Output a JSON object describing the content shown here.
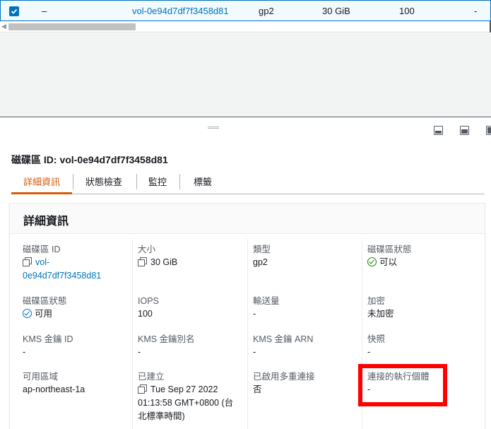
{
  "table": {
    "row": {
      "checked": true,
      "name": "–",
      "volume_id": "vol-0e94d7df7f3458d81",
      "type": "gp2",
      "size": "30 GiB",
      "iops": "100",
      "throughput": "-"
    }
  },
  "detail": {
    "title": "磁碟區 ID: vol-0e94d7df7f3458d81",
    "tabs": [
      {
        "label": "詳細資訊",
        "active": true
      },
      {
        "label": "狀態檢查",
        "active": false
      },
      {
        "label": "監控",
        "active": false
      },
      {
        "label": "標籤",
        "active": false
      }
    ],
    "card_title": "詳細資訊",
    "fields": {
      "volume_id": {
        "label": "磁碟區 ID",
        "value_line1": "vol-",
        "value_line2": "0e94d7df7f3458d81"
      },
      "size": {
        "label": "大小",
        "value": "30 GiB"
      },
      "type": {
        "label": "類型",
        "value": "gp2"
      },
      "volume_status": {
        "label": "磁碟區狀態",
        "value": "可以"
      },
      "volume_state": {
        "label": "磁碟區狀態",
        "value": "可用"
      },
      "iops": {
        "label": "IOPS",
        "value": "100"
      },
      "throughput": {
        "label": "輸送量",
        "value": "-"
      },
      "encryption": {
        "label": "加密",
        "value": "未加密"
      },
      "kms_key_id": {
        "label": "KMS 金鑰 ID",
        "value": "-"
      },
      "kms_key_alias": {
        "label": "KMS 金鑰別名",
        "value": "-"
      },
      "kms_key_arn": {
        "label": "KMS 金鑰 ARN",
        "value": "-"
      },
      "snapshot": {
        "label": "快照",
        "value": "-"
      },
      "availability_zone": {
        "label": "可用區域",
        "value": "ap-northeast-1a"
      },
      "created": {
        "label": "已建立",
        "value_line1": "Tue Sep 27 2022",
        "value_line2": "01:13:58 GMT+0800 (台",
        "value_line3": "北標準時間)"
      },
      "multi_attach": {
        "label": "已啟用多重連接",
        "value": "否"
      },
      "attached_instances": {
        "label": "連接的執行個體",
        "value": "-"
      }
    }
  },
  "colors": {
    "link": "#0073bb",
    "active_tab": "#d45b07",
    "ok": "#1d8102",
    "highlight": "#ff0000"
  }
}
